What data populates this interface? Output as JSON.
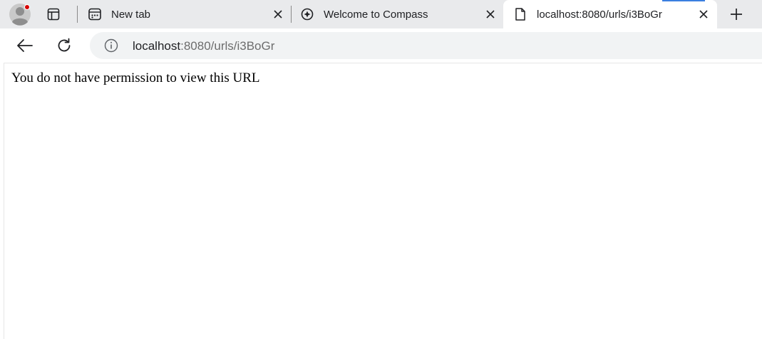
{
  "tabs": [
    {
      "title": "New tab",
      "icon": "new-tab-icon",
      "active": false
    },
    {
      "title": "Welcome to Compass",
      "icon": "compass-icon",
      "active": false
    },
    {
      "title": "localhost:8080/urls/i3BoGr",
      "icon": "document-icon",
      "active": true
    }
  ],
  "address_bar": {
    "host": "localhost",
    "path": ":8080/urls/i3BoGr"
  },
  "page": {
    "message": "You do not have permission to view this URL"
  },
  "colors": {
    "tabstrip_bg": "#e9eaec",
    "omnibox_bg": "#f1f3f4",
    "profile_badge": "#d60000"
  }
}
